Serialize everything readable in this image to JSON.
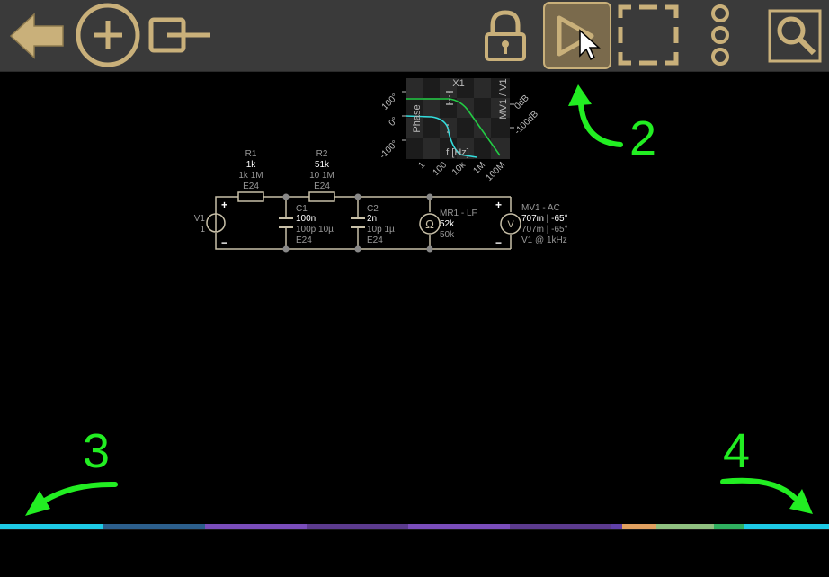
{
  "toolbar": {
    "buttons": [
      {
        "name": "back-button",
        "icon": "arrow-left-icon"
      },
      {
        "name": "add-button",
        "icon": "plus-circle-icon"
      },
      {
        "name": "place-component-button",
        "icon": "component-icon"
      },
      {
        "name": "lock-button",
        "icon": "lock-icon"
      },
      {
        "name": "run-button",
        "icon": "play-icon",
        "active": true
      },
      {
        "name": "select-button",
        "icon": "selection-icon"
      },
      {
        "name": "more-button",
        "icon": "vertical-dots-icon"
      },
      {
        "name": "zoom-button",
        "icon": "magnifier-icon"
      }
    ],
    "accent": "#c9b07a"
  },
  "circuit": {
    "plot": {
      "title": "X1",
      "left_axis_label": "Phase",
      "right_axis_label": "MV1 / V1",
      "x_axis_label": "f [Hz]",
      "left_ticks": [
        "100°",
        "0°",
        "-100°"
      ],
      "right_ticks": [
        "0dB",
        "-100dB"
      ],
      "x_ticks": [
        "1",
        "100",
        "10k",
        "1M",
        "100M"
      ]
    },
    "r1": {
      "name": "R1",
      "value": "1k",
      "range": "1k  1M",
      "series": "E24"
    },
    "r2": {
      "name": "R2",
      "value": "51k",
      "range": "10  1M",
      "series": "E24"
    },
    "c1": {
      "name": "C1",
      "value": "100n",
      "range": "100p  10µ",
      "series": "E24"
    },
    "c2": {
      "name": "C2",
      "value": "2n",
      "range": "10p  1µ",
      "series": "E24"
    },
    "v1": {
      "name": "V1",
      "value": "1"
    },
    "mr1": {
      "name": "MR1 - LF",
      "value": "52k",
      "sub": "50k"
    },
    "mv1": {
      "name": "MV1 - AC",
      "value": "707m | -65°",
      "sub": "707m | -65°",
      "ref": "V1 @ 1kHz"
    }
  },
  "annotations": {
    "a2": "2",
    "a3": "3",
    "a4": "4"
  },
  "colors": {
    "annotation": "#22ee22",
    "wire": "#c8c0a8",
    "gain_trace": "#22cc44",
    "phase_trace": "#33dddd"
  }
}
